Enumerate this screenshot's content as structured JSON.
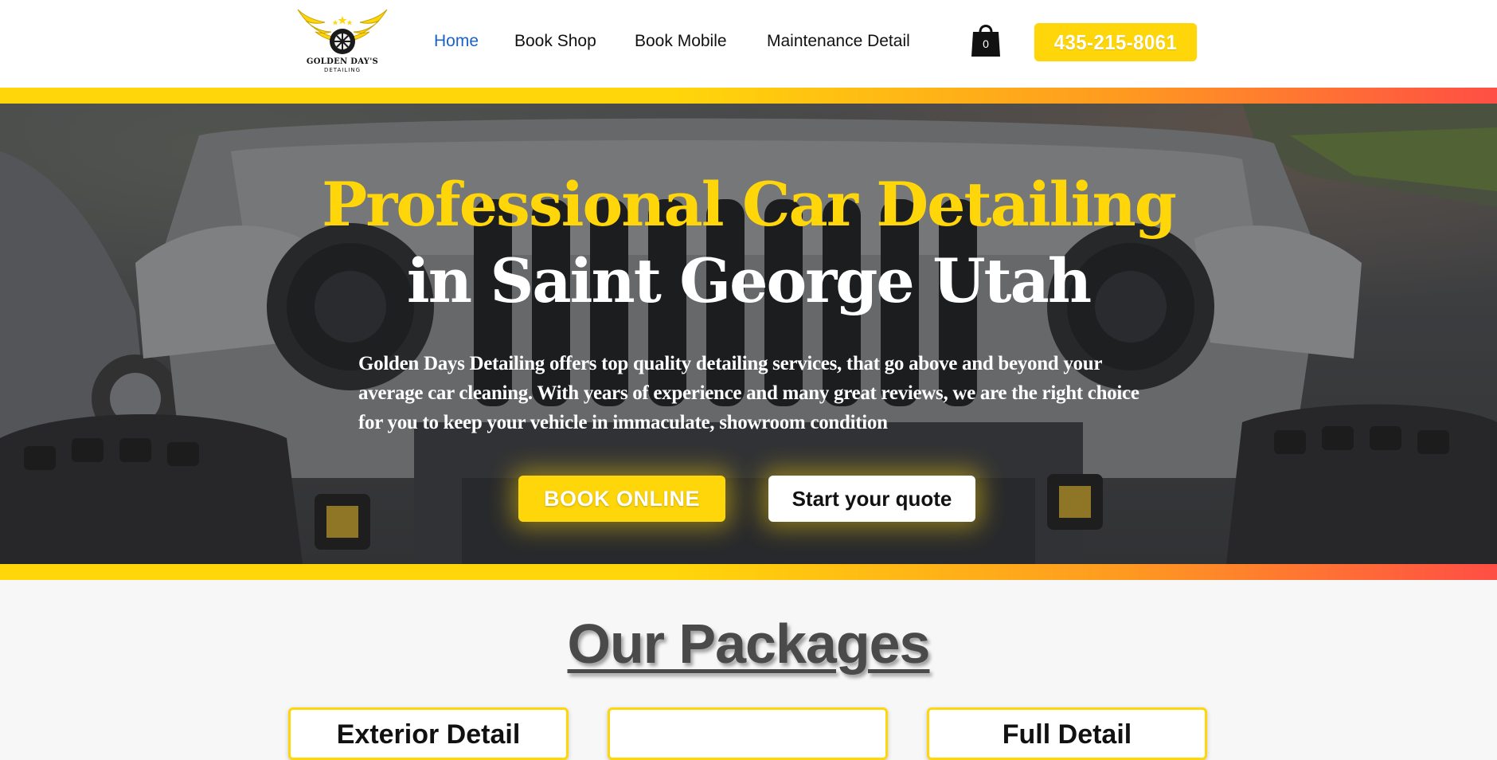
{
  "brand": {
    "logo_line1": "GOLDEN DAY'S",
    "logo_line2": "DETAILING"
  },
  "nav": {
    "items": [
      {
        "label": "Home",
        "active": true
      },
      {
        "label": "Book Shop",
        "active": false
      },
      {
        "label": "Book Mobile",
        "active": false
      },
      {
        "label": "Maintenance Detail",
        "active": false
      }
    ],
    "cart_count": "0",
    "phone": "435-215-8061"
  },
  "hero": {
    "title_line1": "Professional Car Detailing",
    "title_line2": "in Saint George Utah",
    "description": "Golden Days Detailing offers top quality detailing services, that go above and beyond your average car cleaning. With years of experience and many great reviews, we are the right choice for you to keep your vehicle in immaculate, showroom condition",
    "book_button": "BOOK ONLINE",
    "quote_button": "Start your quote"
  },
  "packages": {
    "title": "Our Packages",
    "cards": [
      {
        "title": "Exterior Detail"
      },
      {
        "title": ""
      },
      {
        "title": "Full Detail"
      }
    ]
  },
  "colors": {
    "accent": "#ffd60a",
    "nav_active": "#1b62c8",
    "gradient_end": "#ff4e45"
  }
}
